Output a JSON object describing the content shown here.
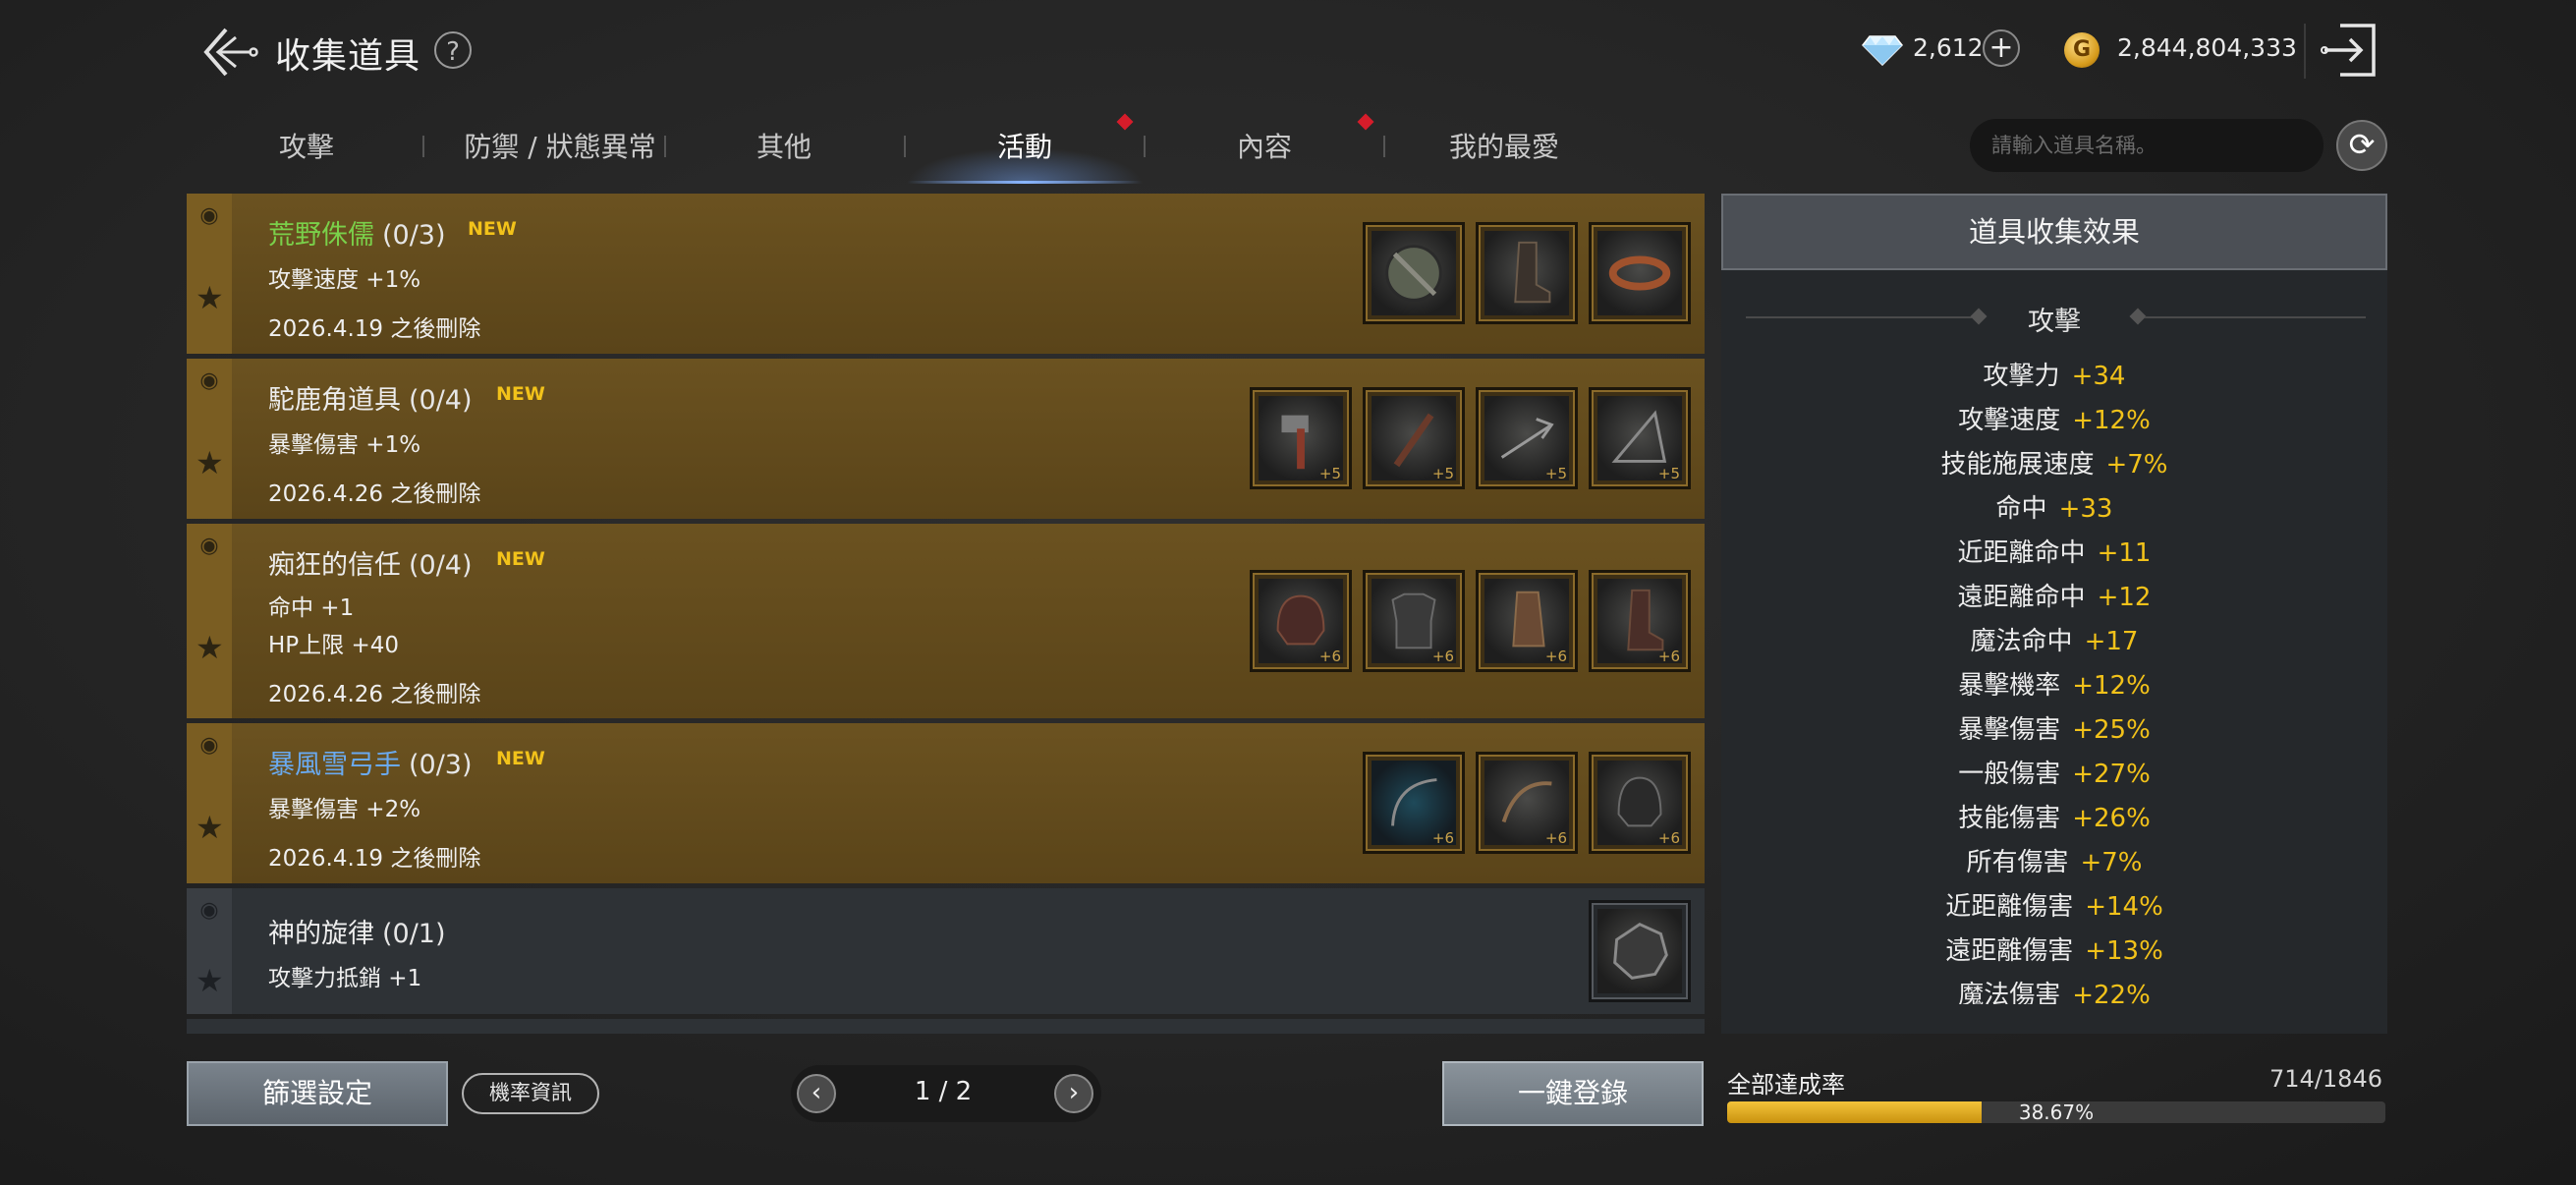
{
  "header": {
    "title": "收集道具",
    "help": "?",
    "diamonds": "2,612",
    "add": "+",
    "coin_symbol": "G",
    "gold": "2,844,804,333"
  },
  "tabs": [
    {
      "label": "攻擊",
      "active": false,
      "dot": false
    },
    {
      "label": "防禦 / 狀態異常",
      "active": false,
      "dot": false
    },
    {
      "label": "其他",
      "active": false,
      "dot": false
    },
    {
      "label": "活動",
      "active": true,
      "dot": true
    },
    {
      "label": "內容",
      "active": false,
      "dot": true
    },
    {
      "label": "我的最愛",
      "active": false,
      "dot": false
    }
  ],
  "search": {
    "placeholder": "請輸入道具名稱。"
  },
  "collections": [
    {
      "name": "荒野侏儒",
      "name_color": "#7ad04a",
      "count": "(0/3)",
      "new": "NEW",
      "lines": [
        "攻擊速度 +1%"
      ],
      "date": "2026.4.19 之後刪除",
      "items": [
        {
          "icon": "shield-icon",
          "plus": ""
        },
        {
          "icon": "boot-icon",
          "plus": ""
        },
        {
          "icon": "belt-icon",
          "plus": ""
        }
      ]
    },
    {
      "name": "駝鹿角道具",
      "name_color": "#efefef",
      "count": "(0/4)",
      "new": "NEW",
      "lines": [
        "暴擊傷害 +1%"
      ],
      "date": "2026.4.26 之後刪除",
      "items": [
        {
          "icon": "axe-icon",
          "plus": "+5"
        },
        {
          "icon": "dagger-icon",
          "plus": "+5"
        },
        {
          "icon": "staff-icon",
          "plus": "+5"
        },
        {
          "icon": "bow-icon",
          "plus": "+5"
        }
      ]
    },
    {
      "name": "痴狂的信任",
      "name_color": "#efefef",
      "count": "(0/4)",
      "new": "NEW",
      "lines": [
        "命中 +1",
        "HP上限 +40"
      ],
      "date": "2026.4.26 之後刪除",
      "items": [
        {
          "icon": "helmet-icon",
          "plus": "+6"
        },
        {
          "icon": "armor-icon",
          "plus": "+6"
        },
        {
          "icon": "gauntlet-icon",
          "plus": "+6"
        },
        {
          "icon": "boot-icon",
          "plus": "+6"
        }
      ]
    },
    {
      "name": "暴風雪弓手",
      "name_color": "#6aaaf0",
      "count": "(0/3)",
      "new": "NEW",
      "lines": [
        "暴擊傷害 +2%"
      ],
      "date": "2026.4.19 之後刪除",
      "items": [
        {
          "icon": "bow-icon",
          "plus": "+6"
        },
        {
          "icon": "bow-icon",
          "plus": "+6"
        },
        {
          "icon": "helmet-icon",
          "plus": "+6"
        }
      ]
    },
    {
      "name": "神的旋律",
      "name_color": "#efefef",
      "count": "(0/1)",
      "new": "",
      "lines": [
        "攻擊力抵銷 +1"
      ],
      "date": "",
      "items": [
        {
          "icon": "stone-icon",
          "plus": ""
        }
      ]
    }
  ],
  "panel": {
    "title": "道具收集效果",
    "section": "攻擊",
    "stats": [
      {
        "label": "攻擊力",
        "value": "+34"
      },
      {
        "label": "攻擊速度",
        "value": "+12%"
      },
      {
        "label": "技能施展速度",
        "value": "+7%"
      },
      {
        "label": "命中",
        "value": "+33"
      },
      {
        "label": "近距離命中",
        "value": "+11"
      },
      {
        "label": "遠距離命中",
        "value": "+12"
      },
      {
        "label": "魔法命中",
        "value": "+17"
      },
      {
        "label": "暴擊機率",
        "value": "+12%"
      },
      {
        "label": "暴擊傷害",
        "value": "+25%"
      },
      {
        "label": "一般傷害",
        "value": "+27%"
      },
      {
        "label": "技能傷害",
        "value": "+26%"
      },
      {
        "label": "所有傷害",
        "value": "+7%"
      },
      {
        "label": "近距離傷害",
        "value": "+14%"
      },
      {
        "label": "遠距離傷害",
        "value": "+13%"
      },
      {
        "label": "魔法傷害",
        "value": "+22%"
      }
    ]
  },
  "footer": {
    "filter": "篩選設定",
    "probability": "機率資訊",
    "page": "1 / 2",
    "prev": "‹",
    "next": "›",
    "register": "一鍵登錄",
    "rate_label": "全部達成率",
    "rate_count": "714/1846",
    "rate_percent": "38.67%",
    "rate_value": 0.3867
  },
  "colors": {
    "accent_gold": "#f2c21a",
    "row_gold": "#6b5220",
    "row_gray": "#2e3236",
    "new_tag": "#f2c21a"
  }
}
